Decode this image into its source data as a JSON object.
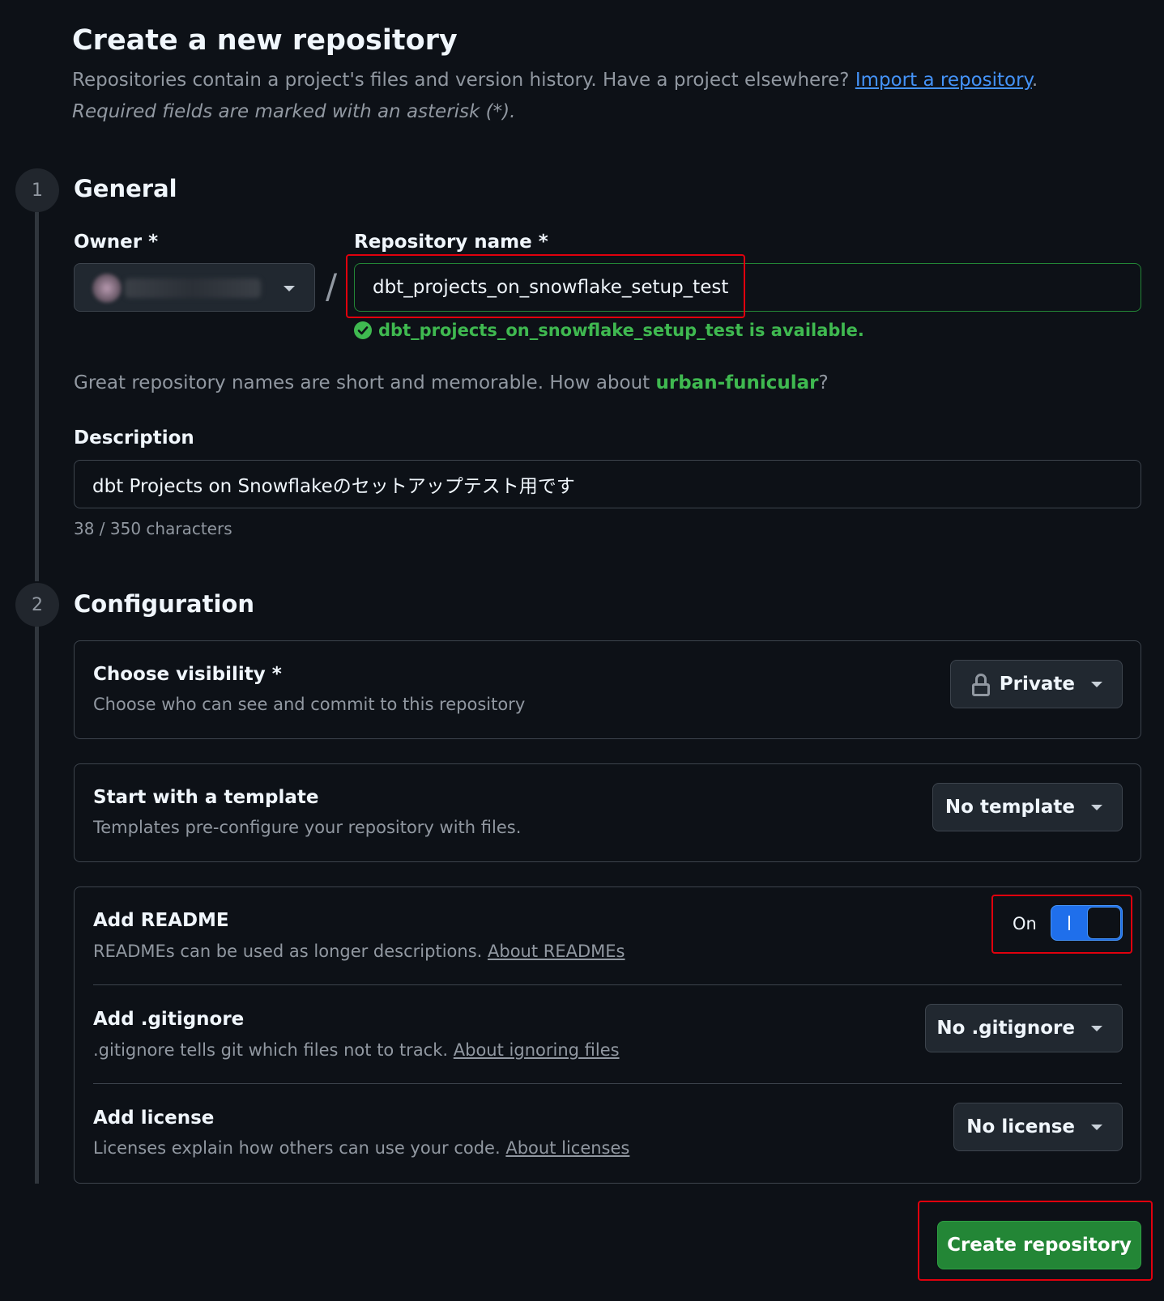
{
  "header": {
    "title": "Create a new repository",
    "subtitle_text": "Repositories contain a project's files and version history. Have a project elsewhere?",
    "import_link": "Import a repository",
    "subtitle_end": ".",
    "required_note": "Required fields are marked with an asterisk (*)."
  },
  "steps": {
    "general": {
      "number": "1",
      "title": "General"
    },
    "configuration": {
      "number": "2",
      "title": "Configuration"
    }
  },
  "owner": {
    "label": "Owner *"
  },
  "repo": {
    "label": "Repository name *",
    "value": "dbt_projects_on_snowflake_setup_test",
    "availability": "dbt_projects_on_snowflake_setup_test is available.",
    "separator": "/"
  },
  "suggestion": {
    "prefix": "Great repository names are short and memorable. How about ",
    "name": "urban-funicular",
    "suffix": "?"
  },
  "description": {
    "label": "Description",
    "value": "dbt Projects on Snowflakeのセットアップテスト用です",
    "char_count": "38 / 350 characters"
  },
  "visibility": {
    "title": "Choose visibility *",
    "desc": "Choose who can see and commit to this repository",
    "selected": "Private"
  },
  "template": {
    "title": "Start with a template",
    "desc": "Templates pre-configure your repository with files.",
    "selected": "No template"
  },
  "readme": {
    "title": "Add README",
    "desc": "READMEs can be used as longer descriptions.",
    "link": "About READMEs",
    "toggle_label": "On",
    "toggle_on": true
  },
  "gitignore": {
    "title": "Add .gitignore",
    "desc": ".gitignore tells git which files not to track.",
    "link": "About ignoring files",
    "selected": "No .gitignore"
  },
  "license": {
    "title": "Add license",
    "desc": "Licenses explain how others can use your code.",
    "link": "About licenses",
    "selected": "No license"
  },
  "submit": {
    "label": "Create repository"
  },
  "colors": {
    "background": "#0d1117",
    "accent_green": "#238636",
    "success_text": "#3fb950",
    "link_blue": "#4493f8",
    "toggle_blue": "#1f6feb",
    "highlight_red": "#e0000d"
  }
}
